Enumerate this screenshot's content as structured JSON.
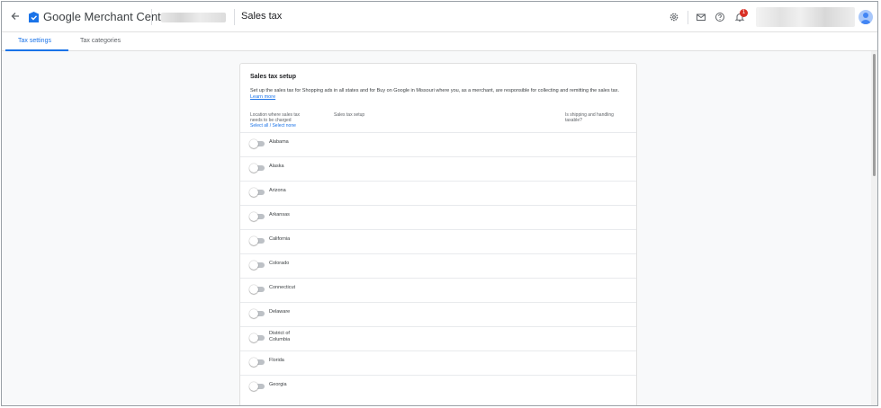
{
  "header": {
    "brand": "Google Merchant Center",
    "page_title": "Sales tax",
    "notification_count": "1"
  },
  "tabs": [
    {
      "label": "Tax settings",
      "active": true
    },
    {
      "label": "Tax categories",
      "active": false
    }
  ],
  "card": {
    "title": "Sales tax setup",
    "description": "Set up the sales tax for Shopping ads in all states and for Buy on Google in Missouri where you, as a merchant, are responsible for collecting and remitting the sales tax.",
    "learn_more": "Learn more",
    "columns": {
      "location": "Location where sales tax needs to be charged",
      "setup": "Sales tax setup",
      "shipping": "Is shipping and handling taxable?"
    },
    "select_all": "Select all",
    "separator": "/",
    "select_none": "Select none",
    "states": [
      {
        "name": "Alabama",
        "enabled": false
      },
      {
        "name": "Alaska",
        "enabled": false
      },
      {
        "name": "Arizona",
        "enabled": false
      },
      {
        "name": "Arkansas",
        "enabled": false
      },
      {
        "name": "California",
        "enabled": false
      },
      {
        "name": "Colorado",
        "enabled": false
      },
      {
        "name": "Connecticut",
        "enabled": false
      },
      {
        "name": "Delaware",
        "enabled": false
      },
      {
        "name": "District of Columbia",
        "enabled": false
      },
      {
        "name": "Florida",
        "enabled": false
      },
      {
        "name": "Georgia",
        "enabled": false
      }
    ]
  },
  "colors": {
    "accent": "#1a73e8",
    "badge": "#d93025",
    "toggle_off": "#bdc1c6"
  }
}
